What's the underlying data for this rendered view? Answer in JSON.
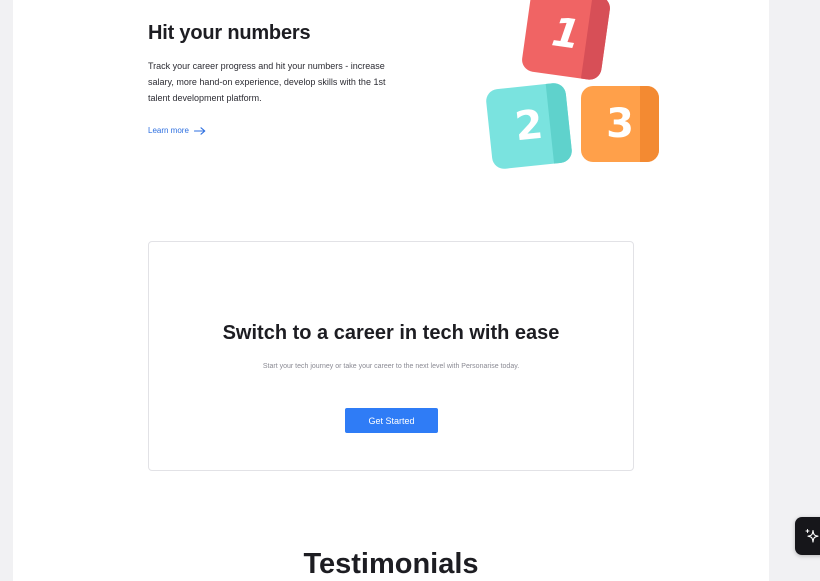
{
  "hero": {
    "title": "Hit your numbers",
    "description": "Track your career progress and hit your numbers - increase salary, more hand-on experience, develop skills with the 1st talent development platform.",
    "learn_more": "Learn more",
    "tiles": [
      "1",
      "2",
      "3"
    ]
  },
  "cta": {
    "title": "Switch to a career in tech with ease",
    "subtitle": "Start your tech journey or take your career to the next level with Personarise today.",
    "button": "Get Started"
  },
  "testimonials": {
    "title": "Testimonials"
  },
  "colors": {
    "accent": "#2f7cf6",
    "tile_red": "#f06464",
    "tile_teal": "#7ae3df",
    "tile_orange": "#ffa04a"
  },
  "icons": {
    "learn_more": "arrow-right-icon",
    "floating_button": "sparkle-icon"
  }
}
